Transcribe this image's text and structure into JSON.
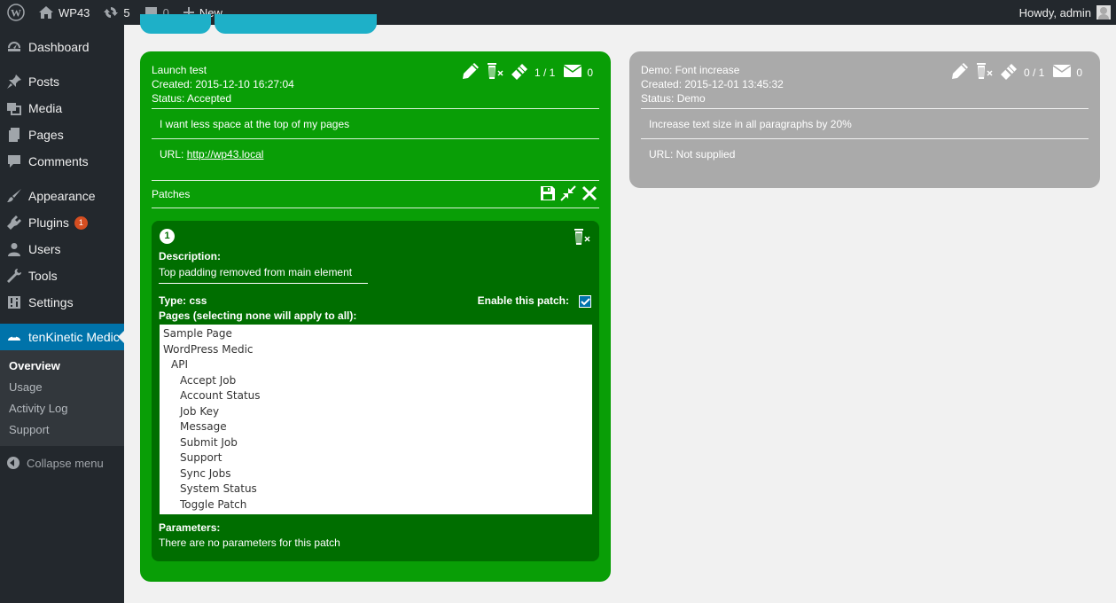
{
  "adminbar": {
    "site_name": "WP43",
    "updates_count": "5",
    "comments_count": "0",
    "new_label": "New",
    "howdy": "Howdy, admin"
  },
  "sidebar": {
    "items": [
      {
        "label": "Dashboard",
        "icon": "dashboard-icon"
      },
      {
        "label": "Posts",
        "icon": "pin-icon"
      },
      {
        "label": "Media",
        "icon": "media-icon"
      },
      {
        "label": "Pages",
        "icon": "pages-icon"
      },
      {
        "label": "Comments",
        "icon": "comment-icon"
      },
      {
        "label": "Appearance",
        "icon": "brush-icon"
      },
      {
        "label": "Plugins",
        "icon": "plugin-icon",
        "badge": "1"
      },
      {
        "label": "Users",
        "icon": "user-icon"
      },
      {
        "label": "Tools",
        "icon": "wrench-icon"
      },
      {
        "label": "Settings",
        "icon": "settings-icon"
      },
      {
        "label": "tenKinetic Medic",
        "icon": "medic-icon"
      }
    ],
    "submenu": [
      "Overview",
      "Usage",
      "Activity Log",
      "Support"
    ],
    "collapse": "Collapse menu"
  },
  "job1": {
    "title": "Launch test",
    "created": "Created: 2015-12-10 16:27:04",
    "status": "Status: Accepted",
    "patch_count": "1 / 1",
    "message_count": "0",
    "description": "I want less space at the top of my pages",
    "url_label": "URL: ",
    "url": "http://wp43.local",
    "patches_label": "Patches",
    "patch": {
      "number": "1",
      "description_label": "Description:",
      "description": "Top padding removed from main element",
      "type": "Type: css",
      "enable_label": "Enable this patch:",
      "pages_label": "Pages (selecting none will apply to all):",
      "pages": [
        "Sample Page",
        "WordPress Medic",
        "API",
        "Accept Job",
        "Account Status",
        "Job Key",
        "Message",
        "Submit Job",
        "Support",
        "Sync Jobs",
        "System Status",
        "Toggle Patch"
      ],
      "parameters_label": "Parameters:",
      "parameters_text": "There are no parameters for this patch"
    }
  },
  "job2": {
    "title": "Demo: Font increase",
    "created": "Created: 2015-12-01 13:45:32",
    "status": "Status: Demo",
    "patch_count": "0 / 1",
    "message_count": "0",
    "description": "Increase text size in all paragraphs by 20%",
    "url_text": "URL: Not supplied"
  },
  "colors": {
    "accepted_card": "#099e06",
    "patch_panel": "#006e00",
    "demo_card": "#aaaaaa",
    "wp_blue": "#0073aa"
  }
}
